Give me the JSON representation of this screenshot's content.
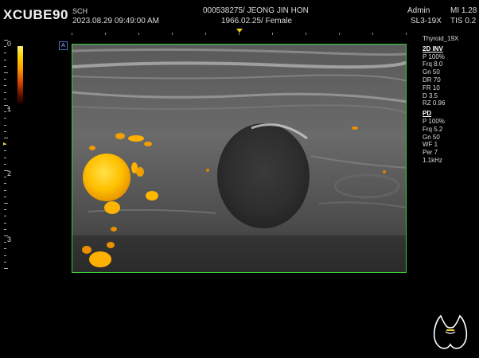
{
  "header": {
    "brand": "XCUBE90",
    "site": "SCH",
    "datetime": "2023.08.29  09:49:00 AM",
    "patient_id": "000538275/ JEONG JIN HON",
    "patient_info": "1966.02.25/ Female",
    "operator": "Admin",
    "mi": "MI 1.28",
    "probe": "SL3-19X",
    "tis": "TIS 0.2"
  },
  "colorbar": {
    "top_label": "0",
    "bottom_label": "-"
  },
  "depth_scale": {
    "labels": [
      "1",
      "2",
      "3"
    ]
  },
  "orientation_marker": "A",
  "params": {
    "preset": "Thyroid_19X",
    "mode_2d": {
      "title": "2D INV",
      "items": [
        "P 100%",
        "Frq 8.0",
        "Gn 50",
        "DR 70",
        "FR 10",
        "D 3.5",
        "RZ 0.96"
      ]
    },
    "mode_pd": {
      "title": "PD",
      "items": [
        "P 100%",
        "Frq 5.2",
        "Gn 50",
        "WF 1",
        "Per 7",
        "1.1kHz"
      ]
    }
  },
  "icons": {
    "thyroid": "thyroid-body-marker-icon",
    "center": "center-line-marker-icon",
    "depth_focus": "focus-depth-marker-icon"
  },
  "colors": {
    "roi_border": "#39d13a",
    "doppler": "#ffc000",
    "marker": "#f0d020"
  }
}
